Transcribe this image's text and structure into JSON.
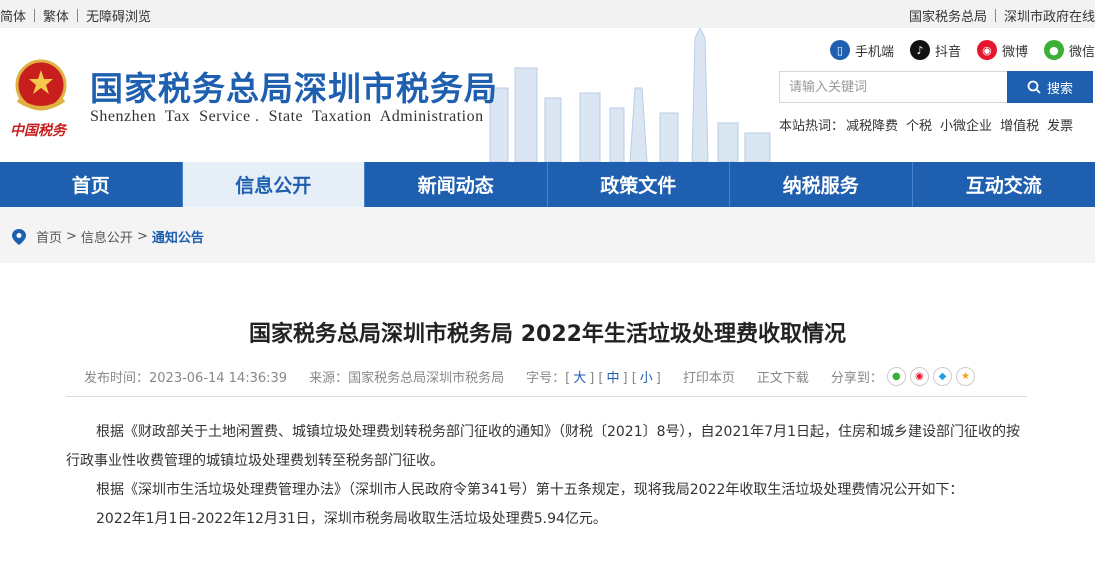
{
  "topbar": {
    "left_links": [
      "简体",
      "繁体",
      "无障碍浏览"
    ],
    "right_links": [
      "国家税务总局",
      "深圳市政府在线"
    ]
  },
  "header": {
    "title": "国家税务总局深圳市税务局",
    "subtitle": "Shenzhen  Tax  Service .  State  Taxation  Administration",
    "emblem_text": "中国税务",
    "social": [
      {
        "label": "手机端",
        "icon": "mobile-icon",
        "color": "#1e5fb0"
      },
      {
        "label": "抖音",
        "icon": "douyin-icon",
        "color": "#111111"
      },
      {
        "label": "微博",
        "icon": "weibo-icon",
        "color": "#e6162d"
      },
      {
        "label": "微信",
        "icon": "wechat-icon",
        "color": "#3cb034"
      }
    ],
    "search": {
      "placeholder": "请输入关键词",
      "button_label": "搜索"
    },
    "hotwords_label": "本站热词：",
    "hotwords": [
      "减税降费",
      "个税",
      "小微企业",
      "增值税",
      "发票"
    ]
  },
  "nav": {
    "items": [
      "首页",
      "信息公开",
      "新闻动态",
      "政策文件",
      "纳税服务",
      "互动交流"
    ],
    "active": "信息公开"
  },
  "breadcrumb": {
    "items": [
      "首页",
      "信息公开",
      "通知公告"
    ]
  },
  "article": {
    "title": "国家税务总局深圳市税务局 2022年生活垃圾处理费收取情况",
    "publish_time": "发布时间：2023-06-14 14:36:39",
    "source": "来源：国家税务总局深圳市税务局",
    "font_size_label": "字号：",
    "font_sizes": [
      "大",
      "中",
      "小"
    ],
    "print_label": "打印本页",
    "download_label": "正文下载",
    "share_label": "分享到：",
    "paragraphs": [
      "根据《财政部关于土地闲置费、城镇垃圾处理费划转税务部门征收的通知》（财税〔2021〕8号），自2021年7月1日起，住房和城乡建设部门征收的按行政事业性收费管理的城镇垃圾处理费划转至税务部门征收。",
      "根据《深圳市生活垃圾处理费管理办法》（深圳市人民政府令第341号）第十五条规定，现将我局2022年收取生活垃圾处理费情况公开如下：",
      "2022年1月1日-2022年12月31日，深圳市税务局收取生活垃圾处理费5.94亿元。"
    ]
  },
  "colors": {
    "brand_blue": "#1e5fb0",
    "nav_active_bg": "#e6eef8"
  }
}
